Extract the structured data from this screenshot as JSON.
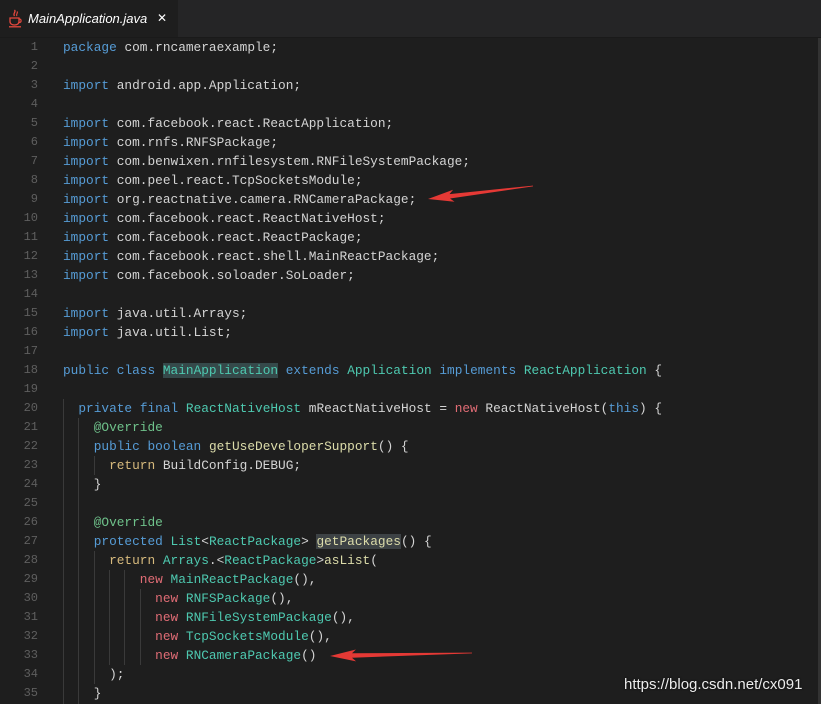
{
  "theme": {
    "bg": "#1e1e1e",
    "tabbar": "#252526",
    "tab_active": "#1e1e1e",
    "text": "#d4d4d4",
    "line_number": "#5f5f5f",
    "keyword": "#569cd6",
    "type": "#4ec9b0",
    "method": "#dcdcaa",
    "new": "#e06c75",
    "return": "#d7ba7d",
    "annotation": "#6fc28b",
    "highlight_type": "#35494a",
    "highlight_method": "#3d4245",
    "indent_guide": "#3a3a3a",
    "arrow": "#e53935"
  },
  "tab": {
    "title": "MainApplication.java",
    "icon": "java-file-icon",
    "close_glyph": "✕",
    "close_icon": "close-icon"
  },
  "editor": {
    "lines": [
      {
        "n": "1",
        "tokens": [
          {
            "t": "keyword",
            "v": "package"
          },
          {
            "t": "text",
            "v": " com.rncameraexample;"
          }
        ]
      },
      {
        "n": "2",
        "tokens": []
      },
      {
        "n": "3",
        "tokens": [
          {
            "t": "keyword",
            "v": "import"
          },
          {
            "t": "text",
            "v": " android.app.Application;"
          }
        ]
      },
      {
        "n": "4",
        "tokens": []
      },
      {
        "n": "5",
        "tokens": [
          {
            "t": "keyword",
            "v": "import"
          },
          {
            "t": "text",
            "v": " com.facebook.react.ReactApplication;"
          }
        ]
      },
      {
        "n": "6",
        "tokens": [
          {
            "t": "keyword",
            "v": "import"
          },
          {
            "t": "text",
            "v": " com.rnfs.RNFSPackage;"
          }
        ]
      },
      {
        "n": "7",
        "tokens": [
          {
            "t": "keyword",
            "v": "import"
          },
          {
            "t": "text",
            "v": " com.benwixen.rnfilesystem.RNFileSystemPackage;"
          }
        ]
      },
      {
        "n": "8",
        "tokens": [
          {
            "t": "keyword",
            "v": "import"
          },
          {
            "t": "text",
            "v": " com.peel.react.TcpSocketsModule;"
          }
        ]
      },
      {
        "n": "9",
        "tokens": [
          {
            "t": "keyword",
            "v": "import"
          },
          {
            "t": "text",
            "v": " org.reactnative.camera.RNCameraPackage;"
          }
        ]
      },
      {
        "n": "10",
        "tokens": [
          {
            "t": "keyword",
            "v": "import"
          },
          {
            "t": "text",
            "v": " com.facebook.react.ReactNativeHost;"
          }
        ]
      },
      {
        "n": "11",
        "tokens": [
          {
            "t": "keyword",
            "v": "import"
          },
          {
            "t": "text",
            "v": " com.facebook.react.ReactPackage;"
          }
        ]
      },
      {
        "n": "12",
        "tokens": [
          {
            "t": "keyword",
            "v": "import"
          },
          {
            "t": "text",
            "v": " com.facebook.react.shell.MainReactPackage;"
          }
        ]
      },
      {
        "n": "13",
        "tokens": [
          {
            "t": "keyword",
            "v": "import"
          },
          {
            "t": "text",
            "v": " com.facebook.soloader.SoLoader;"
          }
        ]
      },
      {
        "n": "14",
        "tokens": []
      },
      {
        "n": "15",
        "tokens": [
          {
            "t": "keyword",
            "v": "import"
          },
          {
            "t": "text",
            "v": " java.util.Arrays;"
          }
        ]
      },
      {
        "n": "16",
        "tokens": [
          {
            "t": "keyword",
            "v": "import"
          },
          {
            "t": "text",
            "v": " java.util.List;"
          }
        ]
      },
      {
        "n": "17",
        "tokens": []
      },
      {
        "n": "18",
        "tokens": [
          {
            "t": "keyword",
            "v": "public"
          },
          {
            "t": "text",
            "v": " "
          },
          {
            "t": "keyword",
            "v": "class"
          },
          {
            "t": "text",
            "v": " "
          },
          {
            "t": "type-highlighted",
            "v": "MainApplication"
          },
          {
            "t": "text",
            "v": " "
          },
          {
            "t": "keyword",
            "v": "extends"
          },
          {
            "t": "text",
            "v": " "
          },
          {
            "t": "type",
            "v": "Application"
          },
          {
            "t": "text",
            "v": " "
          },
          {
            "t": "keyword",
            "v": "implements"
          },
          {
            "t": "text",
            "v": " "
          },
          {
            "t": "type",
            "v": "ReactApplication"
          },
          {
            "t": "text",
            "v": " {"
          }
        ]
      },
      {
        "n": "19",
        "tokens": []
      },
      {
        "n": "20",
        "tokens": [
          {
            "t": "text",
            "v": "  "
          },
          {
            "t": "keyword",
            "v": "private"
          },
          {
            "t": "text",
            "v": " "
          },
          {
            "t": "keyword",
            "v": "final"
          },
          {
            "t": "text",
            "v": " "
          },
          {
            "t": "type",
            "v": "ReactNativeHost"
          },
          {
            "t": "text",
            "v": " mReactNativeHost = "
          },
          {
            "t": "new",
            "v": "new"
          },
          {
            "t": "text",
            "v": " ReactNativeHost("
          },
          {
            "t": "keyword",
            "v": "this"
          },
          {
            "t": "text",
            "v": ") {"
          }
        ]
      },
      {
        "n": "21",
        "tokens": [
          {
            "t": "text",
            "v": "    "
          },
          {
            "t": "annotation",
            "v": "@Override"
          }
        ]
      },
      {
        "n": "22",
        "tokens": [
          {
            "t": "text",
            "v": "    "
          },
          {
            "t": "keyword",
            "v": "public"
          },
          {
            "t": "text",
            "v": " "
          },
          {
            "t": "keyword",
            "v": "boolean"
          },
          {
            "t": "text",
            "v": " "
          },
          {
            "t": "method",
            "v": "getUseDeveloperSupport"
          },
          {
            "t": "text",
            "v": "() {"
          }
        ]
      },
      {
        "n": "23",
        "tokens": [
          {
            "t": "text",
            "v": "      "
          },
          {
            "t": "return",
            "v": "return"
          },
          {
            "t": "text",
            "v": " BuildConfig.DEBUG;"
          }
        ]
      },
      {
        "n": "24",
        "tokens": [
          {
            "t": "text",
            "v": "    }"
          }
        ]
      },
      {
        "n": "25",
        "tokens": []
      },
      {
        "n": "26",
        "tokens": [
          {
            "t": "text",
            "v": "    "
          },
          {
            "t": "annotation",
            "v": "@Override"
          }
        ]
      },
      {
        "n": "27",
        "tokens": [
          {
            "t": "text",
            "v": "    "
          },
          {
            "t": "keyword",
            "v": "protected"
          },
          {
            "t": "text",
            "v": " "
          },
          {
            "t": "type",
            "v": "List"
          },
          {
            "t": "text",
            "v": "<"
          },
          {
            "t": "type",
            "v": "ReactPackage"
          },
          {
            "t": "text",
            "v": "> "
          },
          {
            "t": "method-highlighted",
            "v": "getPackages"
          },
          {
            "t": "text",
            "v": "() {"
          }
        ]
      },
      {
        "n": "28",
        "tokens": [
          {
            "t": "text",
            "v": "      "
          },
          {
            "t": "return",
            "v": "return"
          },
          {
            "t": "text",
            "v": " "
          },
          {
            "t": "type",
            "v": "Arrays"
          },
          {
            "t": "text",
            "v": ".<"
          },
          {
            "t": "type",
            "v": "ReactPackage"
          },
          {
            "t": "text",
            "v": ">"
          },
          {
            "t": "method",
            "v": "asList"
          },
          {
            "t": "text",
            "v": "("
          }
        ]
      },
      {
        "n": "29",
        "tokens": [
          {
            "t": "text",
            "v": "          "
          },
          {
            "t": "new",
            "v": "new"
          },
          {
            "t": "text",
            "v": " "
          },
          {
            "t": "type",
            "v": "MainReactPackage"
          },
          {
            "t": "text",
            "v": "(),"
          }
        ]
      },
      {
        "n": "30",
        "tokens": [
          {
            "t": "text",
            "v": "            "
          },
          {
            "t": "new",
            "v": "new"
          },
          {
            "t": "text",
            "v": " "
          },
          {
            "t": "type",
            "v": "RNFSPackage"
          },
          {
            "t": "text",
            "v": "(),"
          }
        ]
      },
      {
        "n": "31",
        "tokens": [
          {
            "t": "text",
            "v": "            "
          },
          {
            "t": "new",
            "v": "new"
          },
          {
            "t": "text",
            "v": " "
          },
          {
            "t": "type",
            "v": "RNFileSystemPackage"
          },
          {
            "t": "text",
            "v": "(),"
          }
        ]
      },
      {
        "n": "32",
        "tokens": [
          {
            "t": "text",
            "v": "            "
          },
          {
            "t": "new",
            "v": "new"
          },
          {
            "t": "text",
            "v": " "
          },
          {
            "t": "type",
            "v": "TcpSocketsModule"
          },
          {
            "t": "text",
            "v": "(),"
          }
        ]
      },
      {
        "n": "33",
        "tokens": [
          {
            "t": "text",
            "v": "            "
          },
          {
            "t": "new",
            "v": "new"
          },
          {
            "t": "text",
            "v": " "
          },
          {
            "t": "type",
            "v": "RNCameraPackage"
          },
          {
            "t": "text",
            "v": "()"
          }
        ]
      },
      {
        "n": "34",
        "tokens": [
          {
            "t": "text",
            "v": "      );"
          }
        ]
      },
      {
        "n": "35",
        "tokens": [
          {
            "t": "text",
            "v": "    }"
          }
        ]
      }
    ]
  },
  "watermark": "https://blog.csdn.net/cx091"
}
